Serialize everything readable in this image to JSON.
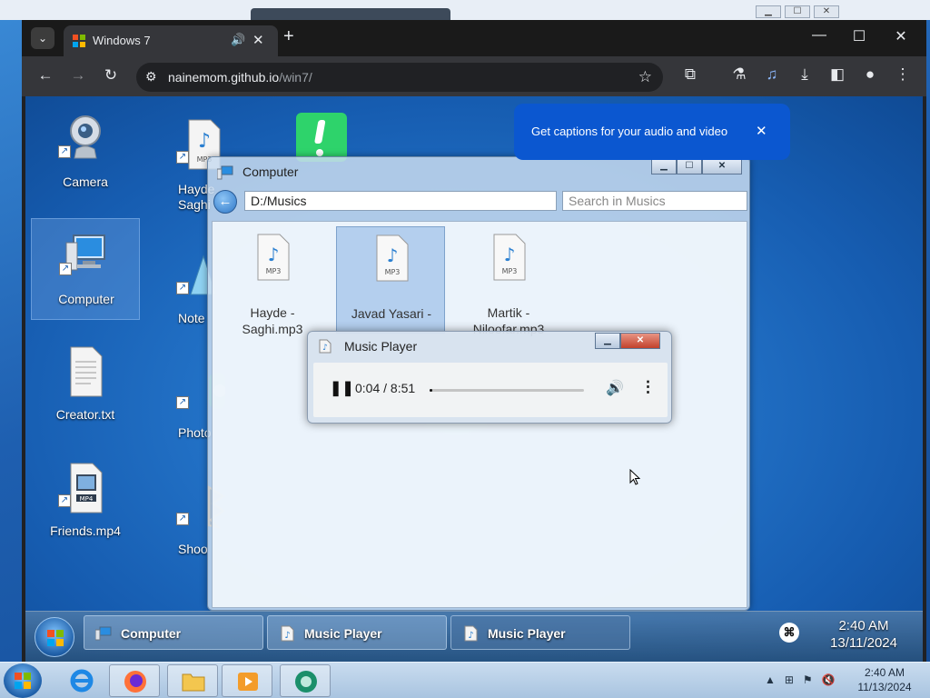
{
  "chrome": {
    "tab_title": "Windows 7",
    "tab_audio_icon": "speaker-icon",
    "new_tab_label": "+",
    "url_host": "nainemom.github.io",
    "url_path": "/win7/",
    "minimize": "—",
    "maximize": "☐",
    "close": "✕"
  },
  "caption_popup": {
    "message": "Get captions for your audio and video",
    "close": "✕"
  },
  "desktop": {
    "icons": [
      {
        "label": "Camera"
      },
      {
        "label": "Computer"
      },
      {
        "label": "Creator.txt"
      },
      {
        "label": "Friends.mp4"
      },
      {
        "label": "Hayde Saghi"
      },
      {
        "label": "Note"
      },
      {
        "label": "Photo"
      },
      {
        "label": "Shoo"
      }
    ]
  },
  "explorer": {
    "title": "Computer",
    "address": "D:/Musics",
    "search_placeholder": "Search in Musics",
    "files": [
      {
        "label": "Hayde - Saghi.mp3"
      },
      {
        "label": "Javad Yasari -"
      },
      {
        "label": "Martik - Niloofar.mp3"
      }
    ]
  },
  "player": {
    "title": "Music Player",
    "time": "0:04 / 8:51",
    "progress_fraction": 0.008
  },
  "w7_taskbar": {
    "items": [
      {
        "label": "Computer"
      },
      {
        "label": "Music Player"
      },
      {
        "label": "Music Player"
      }
    ],
    "clock_time": "2:40 AM",
    "clock_date": "13/11/2024"
  },
  "host_taskbar": {
    "clock_time": "2:40 AM",
    "clock_date": "11/13/2024"
  },
  "colors": {
    "chrome_bg": "#35363a",
    "caption_blue": "#0b57d0",
    "win7_desktop": "#2373c8"
  }
}
